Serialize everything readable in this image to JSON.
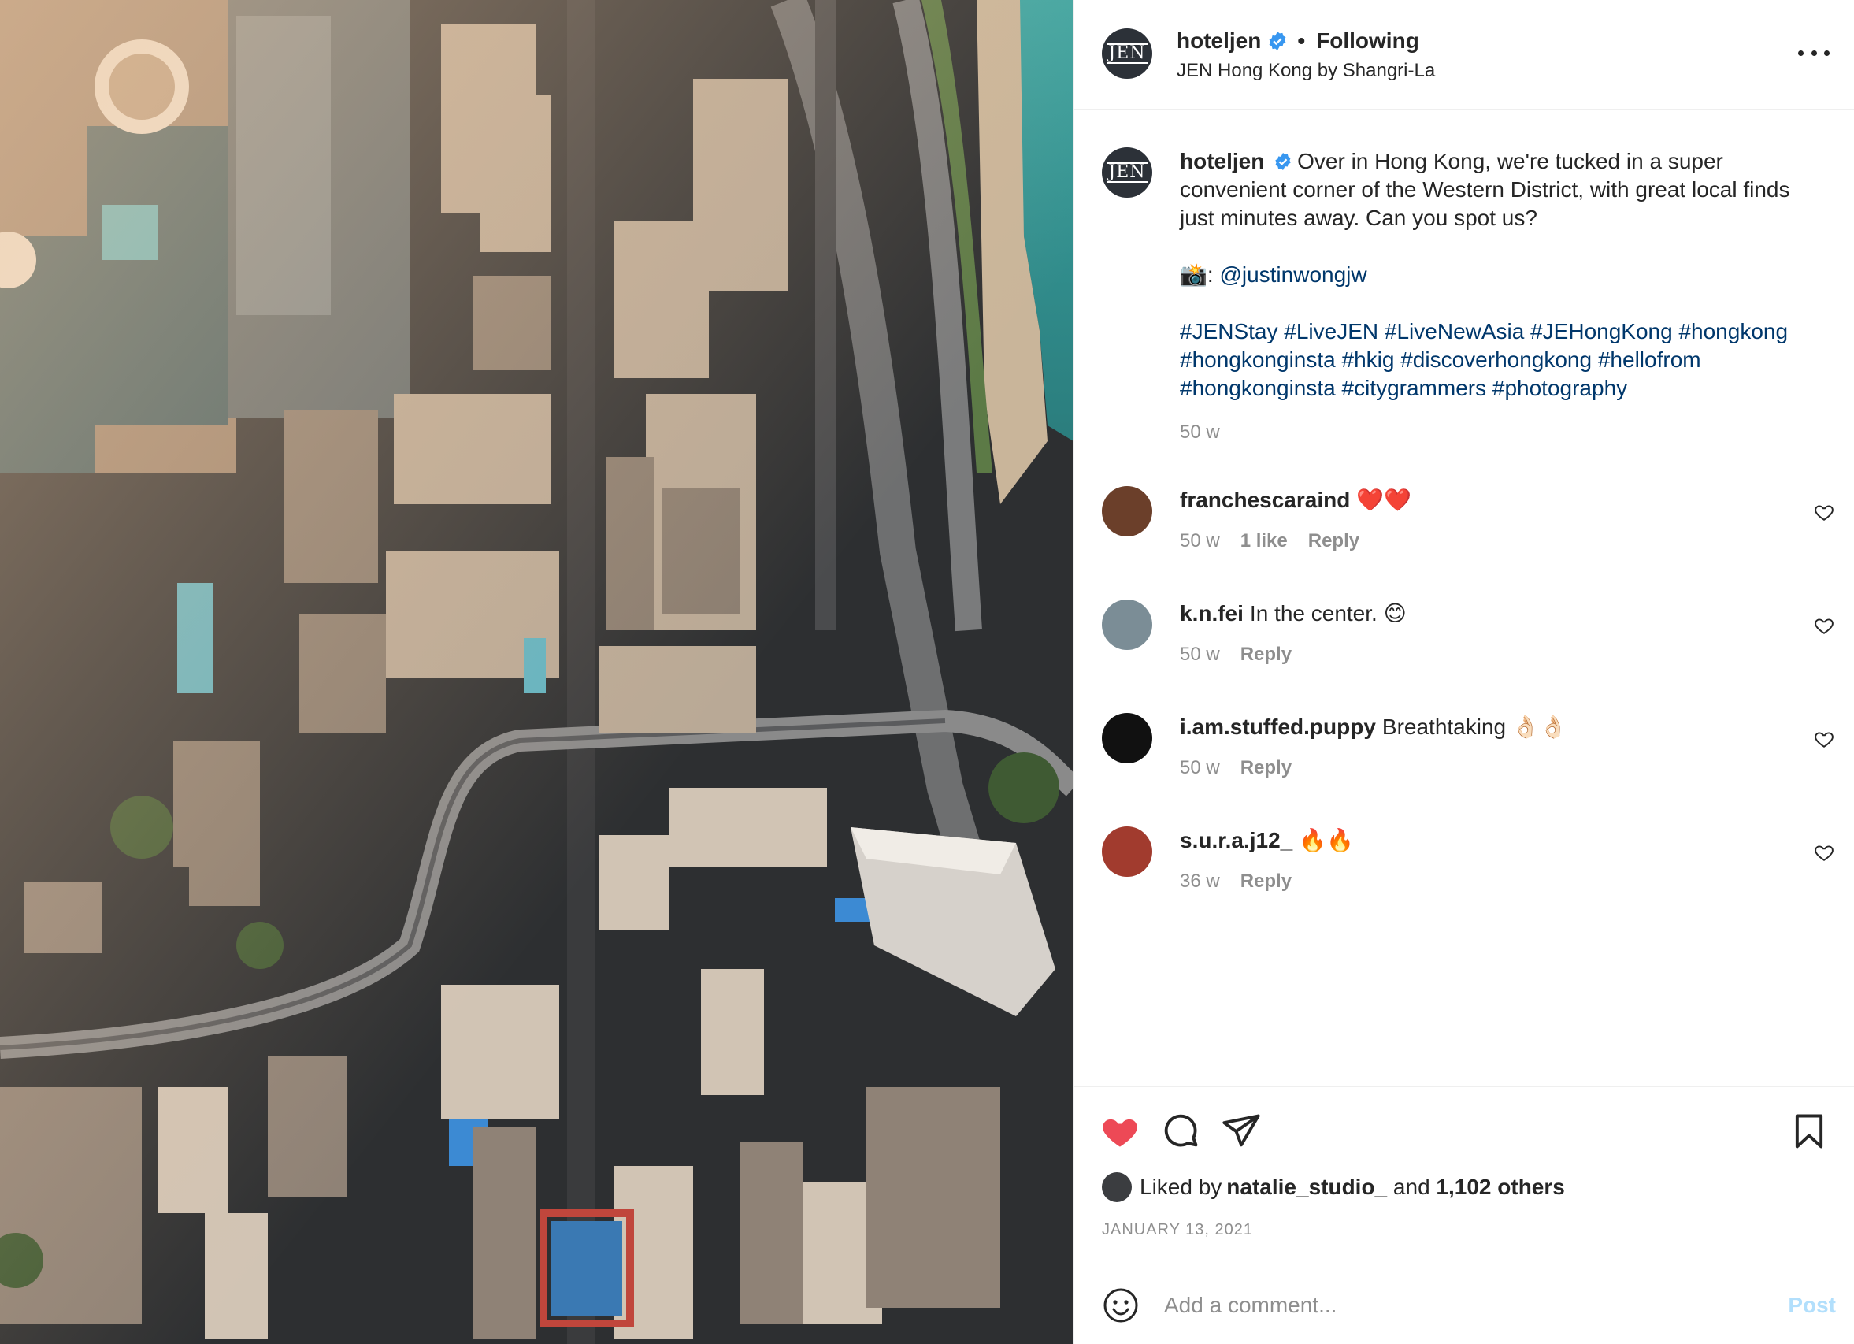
{
  "header": {
    "avatar_text": "JEN",
    "username": "hoteljen",
    "dot": "•",
    "follow_label": "Following",
    "location": "JEN Hong Kong by Shangri-La"
  },
  "caption": {
    "avatar_text": "JEN",
    "username": "hoteljen",
    "line1": "Over in Hong Kong, we're tucked in a super convenient corner of the Western District, with great local finds just minutes away. Can you spot us?",
    "credit_emoji": "📸",
    "credit_sep": ": ",
    "credit_handle": "@justinwongjw",
    "hashtags": [
      "#JENStay",
      "#LiveJEN",
      "#LiveNewAsia",
      "#JEHongKong",
      "#hongkong",
      "#hongkonginsta",
      "#hkig",
      "#discoverhongkong",
      "#hellofrom",
      "#hongkonginsta",
      "#citygrammers",
      "#photography"
    ],
    "time": "50 w"
  },
  "comments": [
    {
      "username": "franchescaraind",
      "text": "❤️❤️",
      "time": "50 w",
      "likes": "1 like",
      "reply": "Reply",
      "avatar_color": "#6b3f2a"
    },
    {
      "username": "k.n.fei",
      "text": "In the center. 😊",
      "time": "50 w",
      "likes": "",
      "reply": "Reply",
      "avatar_color": "#7b8d96"
    },
    {
      "username": "i.am.stuffed.puppy",
      "text": "Breathtaking 👌🏻👌🏻",
      "time": "50 w",
      "likes": "",
      "reply": "Reply",
      "avatar_color": "#111111"
    },
    {
      "username": "s.u.r.a.j12_",
      "text": "🔥🔥",
      "time": "36 w",
      "likes": "",
      "reply": "Reply",
      "avatar_color": "#a13b2e"
    }
  ],
  "likes": {
    "prefix": "Liked by ",
    "user": "natalie_studio_",
    "mid": " and ",
    "count": "1,102 others"
  },
  "date": "JANUARY 13, 2021",
  "add_comment": {
    "placeholder": "Add a comment...",
    "post_label": "Post"
  },
  "colors": {
    "heart_liked": "#ed4956",
    "link": "#00376b",
    "muted": "#8e8e8e",
    "verified": "#3897f0",
    "post_disabled": "#b2dffc"
  },
  "icons": {
    "more": "more-horizontal-icon",
    "like": "heart-filled-icon",
    "comment": "comment-bubble-icon",
    "share": "paper-plane-icon",
    "save": "bookmark-icon",
    "emoji": "smiley-icon",
    "comment_like": "heart-outline-icon"
  }
}
